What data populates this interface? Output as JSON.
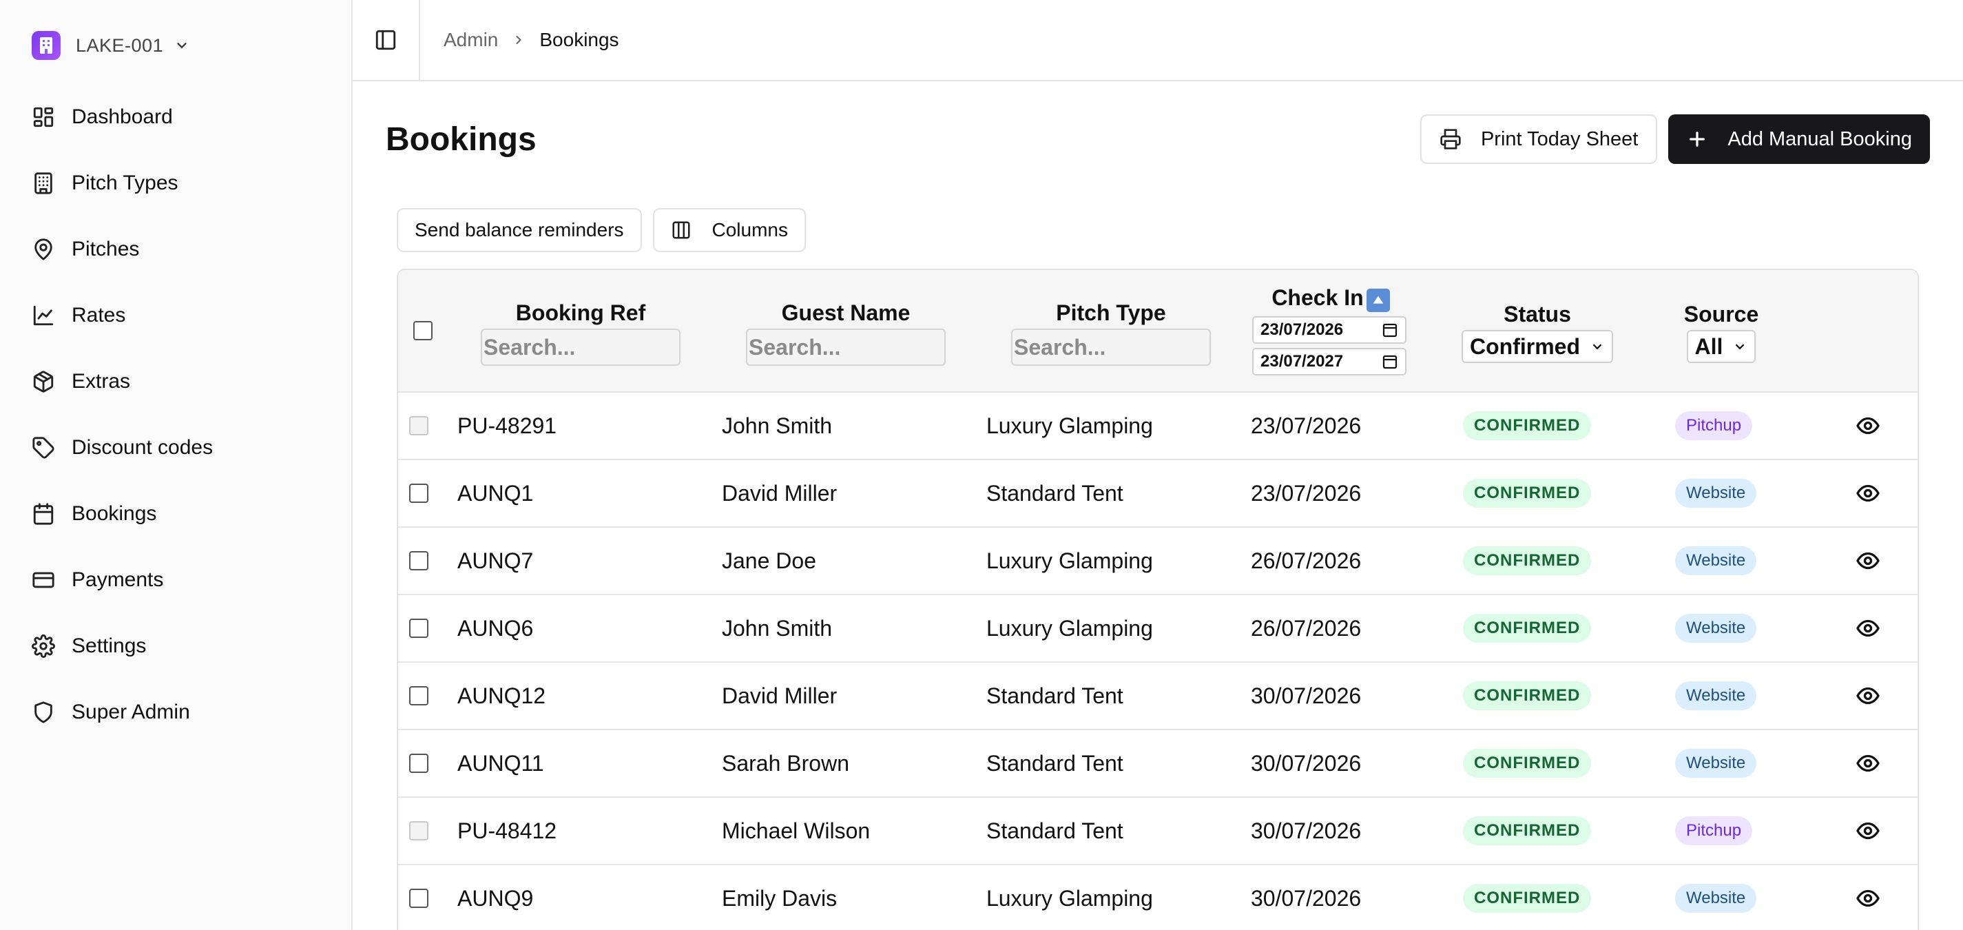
{
  "sidebar": {
    "site_name": "LAKE-001",
    "items": [
      {
        "label": "Dashboard",
        "icon": "dashboard-icon"
      },
      {
        "label": "Pitch Types",
        "icon": "building-icon"
      },
      {
        "label": "Pitches",
        "icon": "map-pin-icon"
      },
      {
        "label": "Rates",
        "icon": "chart-line-icon"
      },
      {
        "label": "Extras",
        "icon": "package-icon"
      },
      {
        "label": "Discount codes",
        "icon": "tag-icon"
      },
      {
        "label": "Bookings",
        "icon": "calendar-icon"
      },
      {
        "label": "Payments",
        "icon": "credit-card-icon"
      },
      {
        "label": "Settings",
        "icon": "gear-icon"
      },
      {
        "label": "Super Admin",
        "icon": "shield-icon"
      }
    ]
  },
  "breadcrumb": {
    "parent": "Admin",
    "current": "Bookings"
  },
  "page": {
    "title": "Bookings",
    "print_label": "Print Today Sheet",
    "add_label": "Add Manual Booking",
    "reminders_label": "Send balance reminders",
    "columns_label": "Columns"
  },
  "table": {
    "headers": {
      "ref": "Booking Ref",
      "guest": "Guest Name",
      "pitch": "Pitch Type",
      "checkin": "Check In",
      "status": "Status",
      "source": "Source"
    },
    "search_placeholder": "Search...",
    "checkin_from": "23/07/2026",
    "checkin_to": "23/07/2027",
    "status_filter": "Confirmed",
    "source_filter": "All",
    "colors": {
      "status_bg": "#dcfce7",
      "pitchup_bg": "#ede4ff",
      "website_bg": "#dbeefe"
    },
    "rows": [
      {
        "ref": "PU-48291",
        "guest": "John Smith",
        "pitch": "Luxury Glamping",
        "checkin": "23/07/2026",
        "status": "CONFIRMED",
        "source": "Pitchup"
      },
      {
        "ref": "AUNQ1",
        "guest": "David Miller",
        "pitch": "Standard Tent",
        "checkin": "23/07/2026",
        "status": "CONFIRMED",
        "source": "Website"
      },
      {
        "ref": "AUNQ7",
        "guest": "Jane Doe",
        "pitch": "Luxury Glamping",
        "checkin": "26/07/2026",
        "status": "CONFIRMED",
        "source": "Website"
      },
      {
        "ref": "AUNQ6",
        "guest": "John Smith",
        "pitch": "Luxury Glamping",
        "checkin": "26/07/2026",
        "status": "CONFIRMED",
        "source": "Website"
      },
      {
        "ref": "AUNQ12",
        "guest": "David Miller",
        "pitch": "Standard Tent",
        "checkin": "30/07/2026",
        "status": "CONFIRMED",
        "source": "Website"
      },
      {
        "ref": "AUNQ11",
        "guest": "Sarah Brown",
        "pitch": "Standard Tent",
        "checkin": "30/07/2026",
        "status": "CONFIRMED",
        "source": "Website"
      },
      {
        "ref": "PU-48412",
        "guest": "Michael Wilson",
        "pitch": "Standard Tent",
        "checkin": "30/07/2026",
        "status": "CONFIRMED",
        "source": "Pitchup"
      },
      {
        "ref": "AUNQ9",
        "guest": "Emily Davis",
        "pitch": "Luxury Glamping",
        "checkin": "30/07/2026",
        "status": "CONFIRMED",
        "source": "Website"
      }
    ]
  }
}
